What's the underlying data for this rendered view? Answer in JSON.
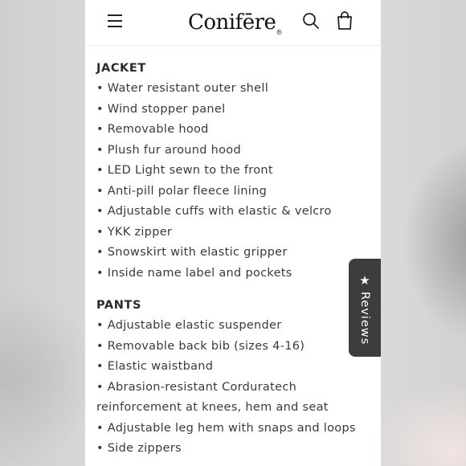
{
  "header": {
    "brand": "Conifēre",
    "brand_mark": "®"
  },
  "sections": [
    {
      "title": "JACKET",
      "items": [
        "• Water resistant outer shell",
        "• Wind stopper panel",
        "• Removable hood",
        "• Plush fur around hood",
        "• LED Light sewn to the front",
        "• Anti-pill polar fleece lining",
        "• Adjustable cuffs with elastic & velcro",
        "• YKK zipper",
        "• Snowskirt with elastic gripper",
        "• Inside name label and pockets"
      ]
    },
    {
      "title": "PANTS",
      "items": [
        "• Adjustable elastic suspender",
        "• Removable back bib (sizes 4-16)",
        "• Elastic waistband",
        "• Abrasion-resistant Corduratech reinforcement at knees, hem and seat",
        "• Adjustable leg hem with snaps and loops",
        "• Side zippers"
      ]
    }
  ],
  "reviews_tab": {
    "label": "Reviews",
    "icon": "star-icon"
  },
  "icons": {
    "menu": "hamburger-menu-icon",
    "search": "search-icon",
    "cart": "cart-icon"
  },
  "colors": {
    "text": "#2b2b2b",
    "tab_bg": "#3d3d3d"
  }
}
